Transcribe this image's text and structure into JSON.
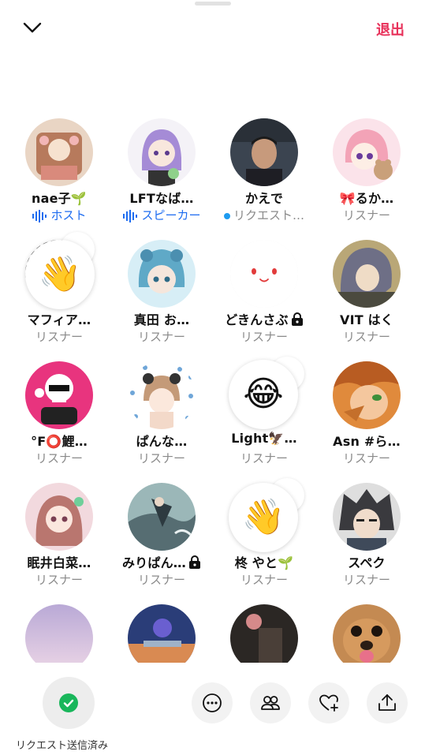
{
  "header": {
    "leave_label": "退出"
  },
  "users": [
    {
      "name": "nae子🌱",
      "role": "ホスト",
      "role_type": "host"
    },
    {
      "name": "LFTなば…",
      "role": "スピーカー",
      "role_type": "speaker"
    },
    {
      "name": "かえで",
      "role": "リクエスト…",
      "role_type": "requested"
    },
    {
      "name": "🎀るか…",
      "role": "リスナー",
      "role_type": "listener"
    },
    {
      "name": "マフィア…",
      "role": "リスナー",
      "role_type": "listener"
    },
    {
      "name": "真田 お…",
      "role": "リスナー",
      "role_type": "listener"
    },
    {
      "name": "どきんさぶ",
      "role": "リスナー",
      "role_type": "listener",
      "locked": true
    },
    {
      "name": "VIT はく",
      "role": "リスナー",
      "role_type": "listener"
    },
    {
      "name": "°F⭕鯉…",
      "role": "リスナー",
      "role_type": "listener"
    },
    {
      "name": "ぱんな…",
      "role": "リスナー",
      "role_type": "listener"
    },
    {
      "name": "Light🦅…",
      "role": "リスナー",
      "role_type": "listener"
    },
    {
      "name": "Asn #ら…",
      "role": "リスナー",
      "role_type": "listener"
    },
    {
      "name": "眠井白菜…",
      "role": "リスナー",
      "role_type": "listener"
    },
    {
      "name": "みりぱん…",
      "role": "リスナー",
      "role_type": "listener",
      "locked": true
    },
    {
      "name": "柊 やと🌱",
      "role": "リスナー",
      "role_type": "listener"
    },
    {
      "name": "スペク",
      "role": "リスナー",
      "role_type": "listener"
    }
  ],
  "reactions": {
    "mafia": "👋",
    "light": "😂",
    "hiiragi": "👋"
  },
  "footer": {
    "request_label": "リクエスト送信済み",
    "icons": [
      "more-icon",
      "people-icon",
      "heart-add-icon",
      "share-icon"
    ]
  },
  "colors": {
    "accent": "#e8315a",
    "host_blue": "#1d6cf0",
    "request_dot": "#1d9bf0",
    "check_green": "#19b65b"
  }
}
